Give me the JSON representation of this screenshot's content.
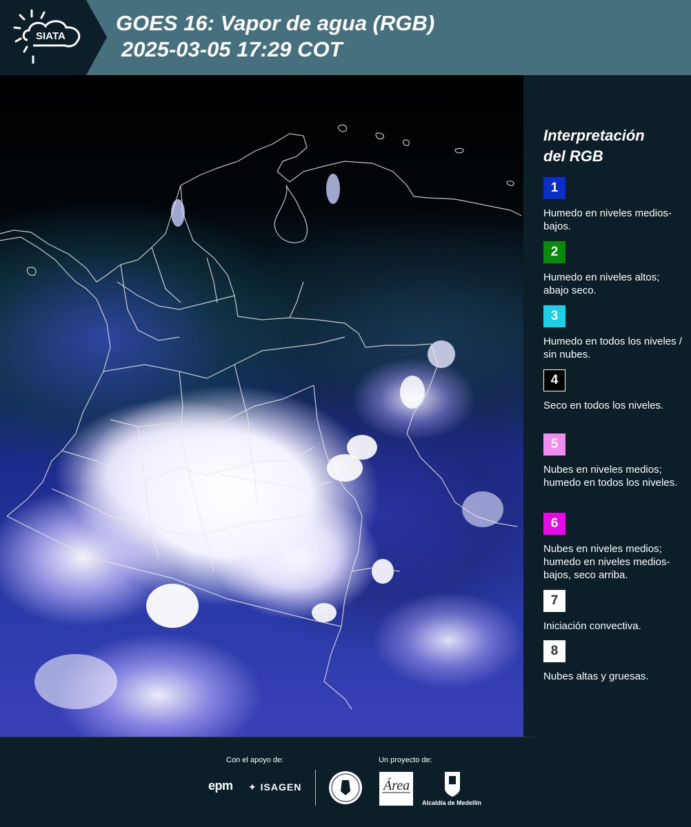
{
  "header": {
    "logo_text": "SIATA",
    "title_line1": "GOES 16: Vapor de agua (RGB)",
    "title_line2": "2025-03-05 17:29 COT"
  },
  "map": {
    "icon": "satellite-water-vapor-image"
  },
  "legend": {
    "title_line1": "Interpretación",
    "title_line2": "del RGB",
    "items": [
      {
        "number": "1",
        "color": "#0a2ec8",
        "text": "Humedo en niveles medios-bajos."
      },
      {
        "number": "2",
        "color": "#0a8a0a",
        "text": "Humedo en niveles altos; abajo seco."
      },
      {
        "number": "3",
        "color": "#1ad0e6",
        "text": "Humedo en todos los niveles / sin nubes."
      },
      {
        "number": "4",
        "color": "#000000",
        "text": "Seco en todos los niveles."
      },
      {
        "number": "5",
        "color": "#f08cf0",
        "text": "Nubes en niveles medios; humedo en todos los niveles."
      },
      {
        "number": "6",
        "color": "#e60ae6",
        "text": "Nubes en niveles medios; humedo en niveles medios-bajos, seco arriba."
      },
      {
        "number": "7",
        "color": "#ffffff",
        "text": "Iniciación convectiva."
      },
      {
        "number": "8",
        "color": "#ffffff",
        "text": "Nubes altas y gruesas."
      }
    ]
  },
  "footer": {
    "support_label": "Con el apoyo de:",
    "project_label": "Un proyecto de:",
    "sponsors": [
      "epm",
      "ISAGEN"
    ],
    "partners": [
      "Área Metropolitana",
      "Alcaldía de Medellín"
    ],
    "alcaldia_label": "Alcaldía de Medellín"
  }
}
